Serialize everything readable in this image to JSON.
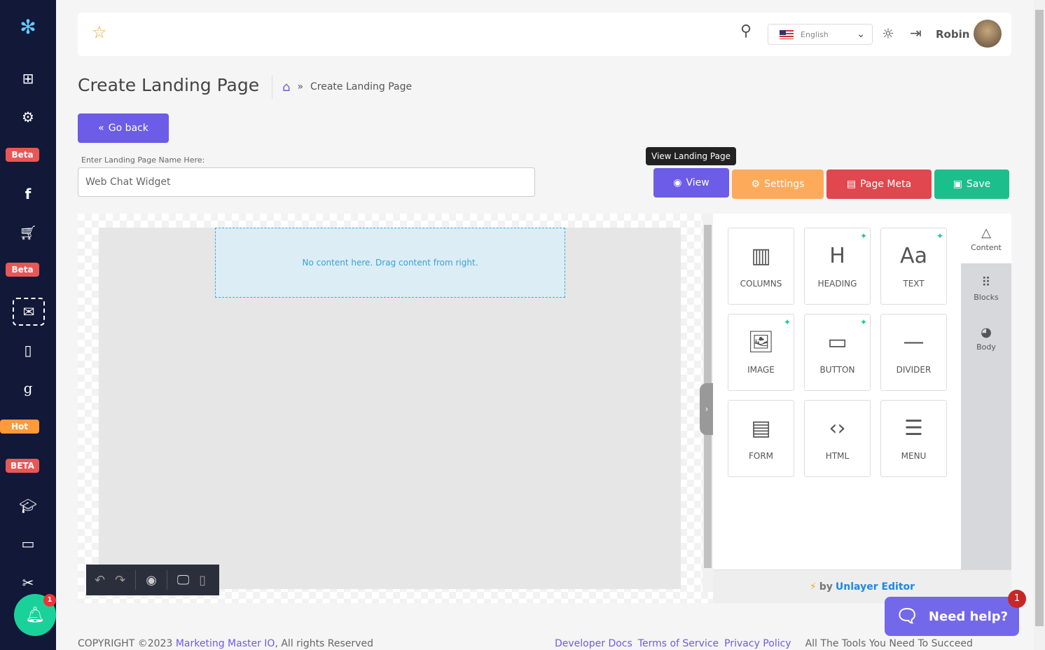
{
  "sidebar": {
    "badges": [
      "Beta",
      "Beta",
      "Hot",
      "BETA"
    ],
    "notification_count": "1",
    "icons": [
      "logo",
      "medkit-icon",
      "gear-icon",
      "facebook-icon",
      "cart-icon",
      "mail-icon",
      "tablet-icon",
      "google-icon",
      "graduation-cap-icon",
      "book-icon",
      "tools-icon",
      "bell-icon"
    ]
  },
  "topbar": {
    "language": "English",
    "username": "Robin"
  },
  "page": {
    "title": "Create Landing Page",
    "breadcrumb": "Create Landing Page",
    "go_back": "Go back",
    "name_label": "Enter Landing Page Name Here:",
    "name_value": "Web Chat Widget"
  },
  "actions": {
    "tooltip": "View Landing Page",
    "view": "View",
    "settings": "Settings",
    "page_meta": "Page Meta",
    "save": "Save",
    "colors": {
      "view": "#6c5ce7",
      "settings": "#fdab5b",
      "page_meta": "#e0474f",
      "save": "#1cbf8c"
    }
  },
  "editor": {
    "empty_text": "No content here. Drag content from right.",
    "tiles": [
      {
        "label": "COLUMNS",
        "icon": "columns-icon",
        "new": false
      },
      {
        "label": "HEADING",
        "icon": "heading-icon",
        "new": true
      },
      {
        "label": "TEXT",
        "icon": "text-icon",
        "new": true
      },
      {
        "label": "IMAGE",
        "icon": "image-icon",
        "new": true
      },
      {
        "label": "BUTTON",
        "icon": "button-icon",
        "new": true
      },
      {
        "label": "DIVIDER",
        "icon": "divider-icon",
        "new": false
      },
      {
        "label": "FORM",
        "icon": "form-icon",
        "new": false
      },
      {
        "label": "HTML",
        "icon": "html-icon",
        "new": false
      },
      {
        "label": "MENU",
        "icon": "menu-icon",
        "new": false
      }
    ],
    "tabs": [
      "Content",
      "Blocks",
      "Body"
    ],
    "by": "by",
    "brand": "Unlayer Editor"
  },
  "help": {
    "label": "Need help?",
    "count": "1"
  },
  "footer": {
    "copyright": "COPYRIGHT ©2023",
    "company": "Marketing Master IO",
    "rights": ", All rights Reserved",
    "links": [
      "Developer Docs",
      "Terms of Service",
      "Privacy Policy"
    ],
    "tagline": "All The Tools You Need To Succeed"
  }
}
